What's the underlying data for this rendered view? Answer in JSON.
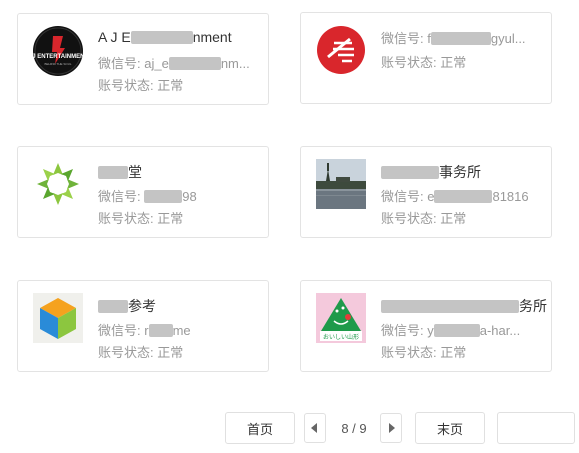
{
  "accounts": [
    {
      "name": "A J E",
      "name_tail": "nment",
      "wechat_label": "微信号: ",
      "wechat_prefix": "aj_e",
      "wechat_tail": "nm...",
      "status": "账号状态: 正常",
      "avatar_icon": "aj-entertainment-logo-icon"
    },
    {
      "name": "",
      "wechat_label": "微信号: ",
      "wechat_prefix": "f",
      "wechat_tail": "gyul...",
      "status": "账号状态: 正常",
      "avatar_icon": "red-circle-logo-icon"
    },
    {
      "name": "",
      "name_tail": "堂",
      "wechat_label": "微信号: ",
      "wechat_prefix": "",
      "wechat_tail": "98",
      "status": "账号状态: 正常",
      "avatar_icon": "green-star-logo-icon"
    },
    {
      "name": "",
      "name_tail": "事务所",
      "wechat_label": "微信号: ",
      "wechat_prefix": "e",
      "wechat_tail": "81816",
      "status": "账号状态: 正常",
      "avatar_icon": "lake-landscape-photo-icon"
    },
    {
      "name": "",
      "name_tail": "参考",
      "wechat_label": "微信号: ",
      "wechat_prefix": "r",
      "wechat_tail": "me",
      "status": "账号状态: 正常",
      "avatar_icon": "colorful-cube-logo-icon"
    },
    {
      "name": "",
      "name_tail": "务所",
      "wechat_label": "微信号: ",
      "wechat_prefix": "y",
      "wechat_tail": "a-har...",
      "status": "账号状态: 正常",
      "avatar_icon": "green-mountain-logo-icon"
    }
  ],
  "pager": {
    "first": "首页",
    "current": "8 / 9",
    "last": "末页",
    "jump_placeholder": ""
  },
  "colors": {
    "border": "#e3e3e3",
    "muted_text": "#999999",
    "redacted": "#c4c4c4"
  }
}
